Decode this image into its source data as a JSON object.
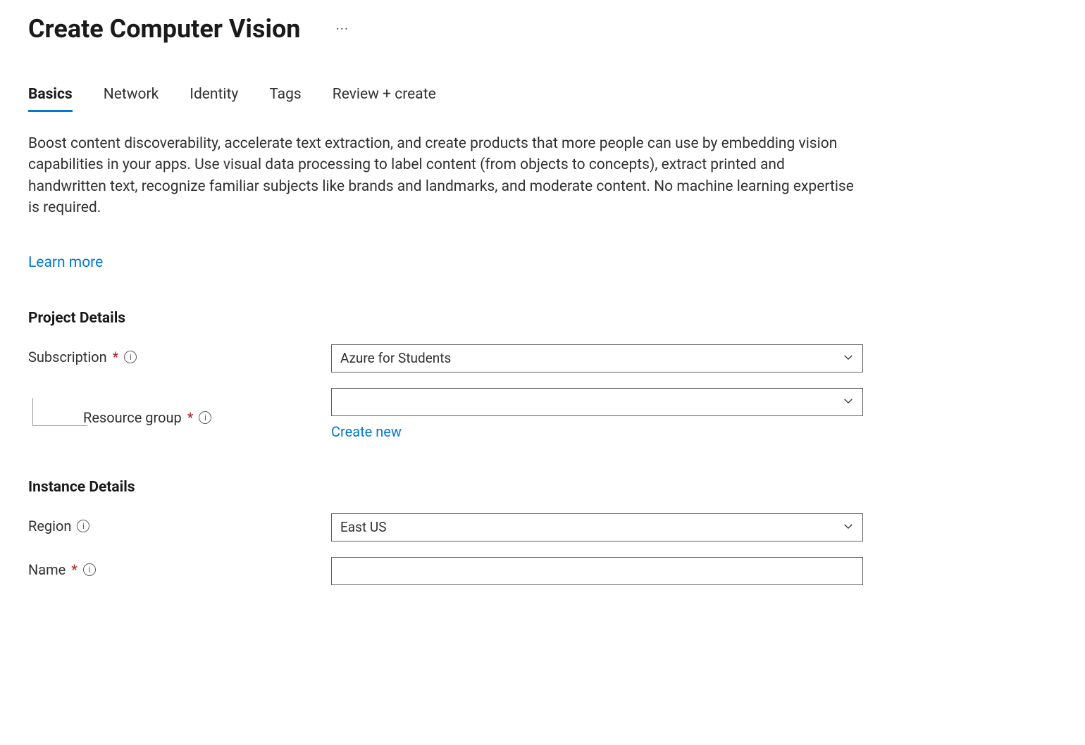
{
  "header": {
    "title": "Create Computer Vision"
  },
  "tabs": {
    "items": [
      {
        "label": "Basics",
        "active": true
      },
      {
        "label": "Network",
        "active": false
      },
      {
        "label": "Identity",
        "active": false
      },
      {
        "label": "Tags",
        "active": false
      },
      {
        "label": "Review + create",
        "active": false
      }
    ]
  },
  "intro": {
    "description": "Boost content discoverability, accelerate text extraction, and create products that more people can use by embedding vision capabilities in your apps. Use visual data processing to label content (from objects to concepts), extract printed and handwritten text, recognize familiar subjects like brands and landmarks, and moderate content. No machine learning expertise is required.",
    "learn_more": "Learn more"
  },
  "sections": {
    "project_details": {
      "title": "Project Details",
      "subscription": {
        "label": "Subscription",
        "value": "Azure for Students"
      },
      "resource_group": {
        "label": "Resource group",
        "value": "",
        "create_new": "Create new"
      }
    },
    "instance_details": {
      "title": "Instance Details",
      "region": {
        "label": "Region",
        "value": "East US"
      },
      "name": {
        "label": "Name",
        "value": ""
      }
    }
  },
  "glyphs": {
    "required": "*",
    "info": "i"
  }
}
